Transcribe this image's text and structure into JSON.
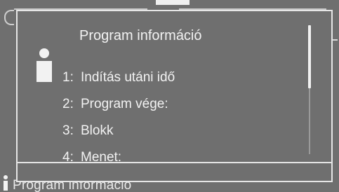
{
  "dialog": {
    "title": "Program információ",
    "items": [
      {
        "number": "1:",
        "label": "Indítás utáni idő"
      },
      {
        "number": "2:",
        "label": "Program vége:"
      },
      {
        "number": "3:",
        "label": "Blokk"
      },
      {
        "number": "4:",
        "label": "Menet:"
      }
    ]
  },
  "background": {
    "bottom_label": "Program információ"
  },
  "icons": {
    "dialog_icon": "info-icon",
    "background_icon": "info-icon"
  },
  "colors": {
    "background": "#6f6f6f",
    "foreground": "#f2f2f2",
    "border": "#e6e6e6"
  }
}
